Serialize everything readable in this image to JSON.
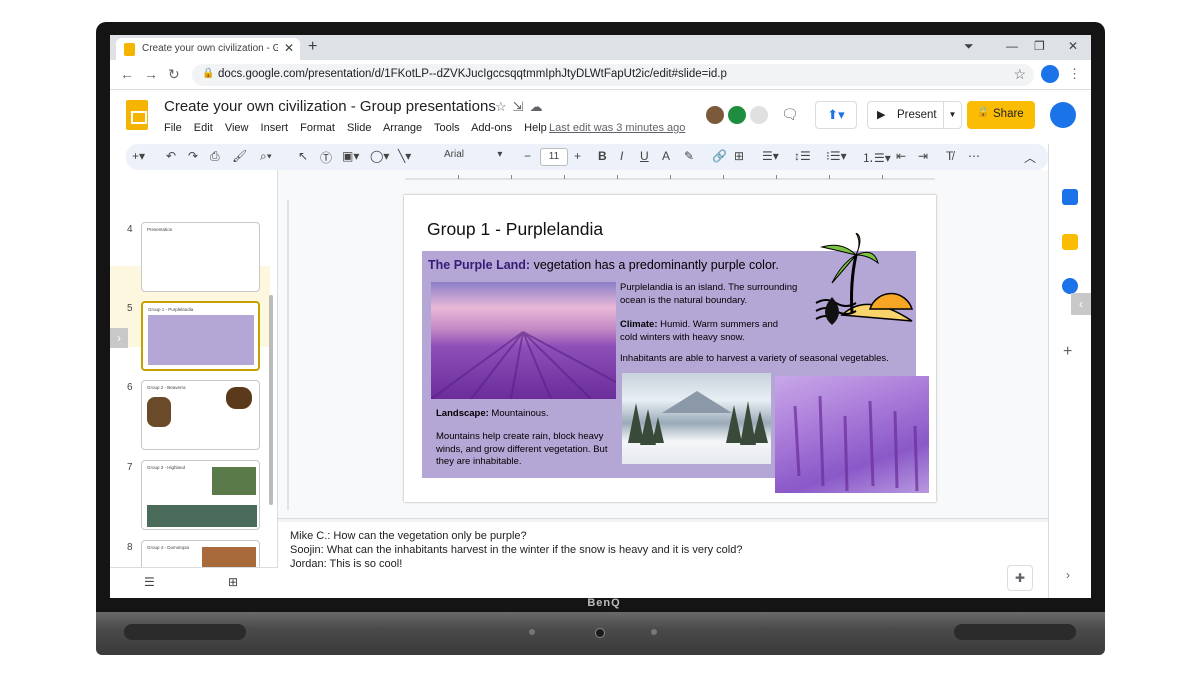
{
  "browser": {
    "tab_title": "Create your own civilization - Gro",
    "url": "docs.google.com/presentation/d/1FKotLP--dZVKJucIgccsqqtmmIphJtyDLWtFapUt2ic/edit#slide=id.p"
  },
  "doc": {
    "title": "Create your own civilization - Group presentations",
    "menu": [
      "File",
      "Edit",
      "View",
      "Insert",
      "Format",
      "Slide",
      "Arrange",
      "Tools",
      "Add-ons",
      "Help"
    ],
    "last_edit": "Last edit was 3 minutes ago",
    "present_label": "Present",
    "share_label": "Share"
  },
  "toolbar": {
    "font": "Arial",
    "font_size": "11"
  },
  "filmstrip": {
    "slides": [
      {
        "number": "4",
        "title": "Presentation"
      },
      {
        "number": "5",
        "title": "Group 1 - Purplelandia"
      },
      {
        "number": "6",
        "title": "Group 2 - Beaverra"
      },
      {
        "number": "7",
        "title": "Group 3 - Highland"
      },
      {
        "number": "8",
        "title": "Group 4 - Domotopia"
      }
    ]
  },
  "slide": {
    "title": "Group 1 - Purplelandia",
    "heading_bold": "The Purple Land:",
    "heading_rest": " vegetation has a predominantly purple color.",
    "island_text": "Purplelandia is an island. The surrounding ocean is the natural boundary.",
    "climate_bold": "Climate:",
    "climate_rest": " Humid. Warm summers and cold winters with heavy snow.",
    "harvest_text": "Inhabitants are able to harvest a variety of seasonal vegetables.",
    "landscape_bold": "Landscape:",
    "landscape_rest": " Mountainous.",
    "mountains_text": "Mountains help create rain, block heavy winds, and grow different vegetation. But they are inhabitable."
  },
  "notes": {
    "lines": [
      "Mike C.: How can the vegetation only be purple?",
      "Soojin: What can the inhabitants harvest in the winter if the snow is heavy and it is very cold?",
      "Jordan: This is so cool!"
    ]
  },
  "device": {
    "brand": "BenQ"
  },
  "colors": {
    "slides_yellow": "#f4b400",
    "share_yellow": "#fbbc04",
    "purple_box": "#b4a7d6",
    "heading_purple": "#351c75"
  }
}
